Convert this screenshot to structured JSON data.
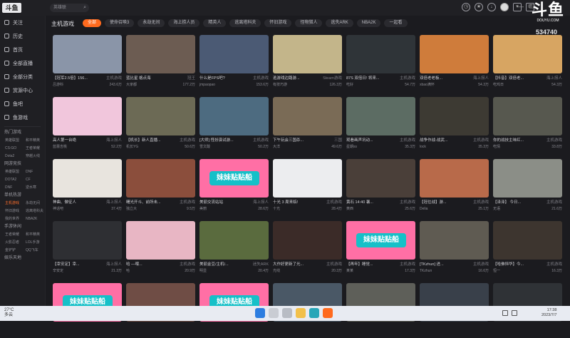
{
  "topbar": {
    "logo_text": "斗鱼",
    "search_placeholder": "英雄联",
    "icons": [
      "history-icon",
      "follow-icon",
      "download-icon",
      "live-icon",
      "avatar",
      "shirt-icon",
      "message-icon",
      "minimize-icon",
      "maximize-icon",
      "close-icon"
    ]
  },
  "watermark": {
    "brand": "斗鱼",
    "domain": "DOUYU.COM",
    "room_number": "534740"
  },
  "sidebar": {
    "nav": [
      {
        "label": "关注",
        "icon": "heart-icon"
      },
      {
        "label": "历史",
        "icon": "clock-icon"
      },
      {
        "label": "首页",
        "icon": "home-icon"
      },
      {
        "label": "全部直播",
        "icon": "grid-icon"
      },
      {
        "label": "全部分类",
        "icon": "category-icon"
      },
      {
        "label": "赏源中心",
        "icon": "gift-icon"
      },
      {
        "label": "鱼吧",
        "icon": "fish-icon"
      },
      {
        "label": "鱼游戏",
        "icon": "gamepad-icon"
      }
    ],
    "sections": [
      {
        "title": "热门游戏",
        "items": [
          "英雄联盟",
          "和平精英",
          "CS:GO",
          "王者荣耀",
          "Dota2",
          "穿越火线"
        ]
      },
      {
        "title": "网游竞技",
        "items": [
          "英雄联盟",
          "DNF",
          "DOTA2",
          "CF",
          "DNF",
          "逆水寒"
        ]
      },
      {
        "title": "单机热游",
        "items": [
          "主机游戏",
          "永劫无间",
          "怀旧游戏",
          "逃离塔科夫",
          "我的世界",
          "NBA2K"
        ]
      },
      {
        "title": "手游休闲",
        "items": [
          "王者荣耀",
          "和平精英",
          "火影忍者",
          "LOL手游",
          "金铲铲",
          "QQ飞车"
        ]
      },
      {
        "title": "娱乐天地",
        "items": []
      }
    ],
    "active_item": "主机游戏"
  },
  "content": {
    "title": "主机游戏",
    "tabs": [
      "全部",
      "使命召唤3",
      "永劫无间",
      "海上捞人员",
      "精英人",
      "逃离塔科夫",
      "怀旧游戏",
      "怪物猎人",
      "逃失ARK",
      "NBA2K",
      "一起看"
    ],
    "active_tab": "全部",
    "cards": [
      {
        "title": "【冠军2.5倍】156...",
        "cat": "主机游戏",
        "streamer": "吕游科",
        "views": "243.6万",
        "color": "#8a95a8"
      },
      {
        "title": "蓝比星 格点海",
        "cat": "冠王",
        "streamer": "大家都",
        "views": "177.2万",
        "color": "#6c5c52"
      },
      {
        "title": "什么是FPS吧?",
        "cat": "主机游戏",
        "streamer": "jmpaopao",
        "views": "153.6万",
        "color": "#4b5a74"
      },
      {
        "title": "逃游戏边路游...",
        "cat": "Steam游戏",
        "streamer": "有技巧游",
        "views": "126.3万",
        "color": "#c3b58a"
      },
      {
        "title": "87S 双倍日! 将来...",
        "cat": "主机游戏",
        "streamer": "吃好",
        "views": "54.7万",
        "color": "#2f3438"
      },
      {
        "title": "双倍老老板...",
        "cat": "海上捞人",
        "streamer": "xbao满怀",
        "views": "54.3万",
        "color": "#cf7c3b"
      },
      {
        "title": "【抖音】双倍老...",
        "cat": "海上捞人",
        "streamer": "吃鸡日",
        "views": "54.3万",
        "color": "#d7a562"
      },
      {
        "title": "高人第一台绝",
        "cat": "海上捞人",
        "streamer": "蓝蕾吉桃",
        "views": "52.2万",
        "color": "#f1c6dc"
      },
      {
        "title": "【机长】新人直播...",
        "cat": "主机游戏",
        "streamer": "机长YG",
        "views": "50.6万",
        "color": "#6c6a55"
      },
      {
        "title": "[大师] 怪扮演试游...",
        "cat": "主机游戏",
        "streamer": "雪文酸",
        "views": "50.2万",
        "color": "#4d6b80"
      },
      {
        "title": "下午玩会三国杀...",
        "cat": "三国",
        "streamer": "大洋",
        "views": "49.6万",
        "color": "#7a6b56"
      },
      {
        "title": "观看画声讯动...",
        "cat": "主机游戏",
        "streamer": "星期ss",
        "views": "35.3万",
        "color": "#5c6c63"
      },
      {
        "title": "战争作战-战武...",
        "cat": "主机游戏",
        "streamer": "lock",
        "views": "35.3万",
        "color": "#3d3a33"
      },
      {
        "title": "你的战技主味红...",
        "cat": "主机游戏",
        "streamer": "吃情",
        "views": "33.8万",
        "color": "#57584f"
      },
      {
        "title": "神曲、做征人",
        "cat": "海上捞人",
        "streamer": "神话吧",
        "views": "37.4万",
        "color": "#e8e4de"
      },
      {
        "title": "曙光开斗、前所未...",
        "cat": "主机游戏",
        "streamer": "独立大",
        "views": "9.5万",
        "color": "#8b4e3c"
      },
      {
        "title": "美丽交流站站",
        "cat": "海上捞人",
        "streamer": "美丽",
        "views": "28.6万",
        "color": "#ff6fa5"
      },
      {
        "title": "十光 3 周来临!",
        "cat": "主机游戏",
        "streamer": "十光",
        "views": "28.4万",
        "color": "#ecedef"
      },
      {
        "title": "黄石 14:40 暑...",
        "cat": "主机游戏",
        "streamer": "黄西",
        "views": "25.6万",
        "color": "#4a3f39"
      },
      {
        "title": "【冠位战】游...",
        "cat": "主机游戏",
        "streamer": "Delia",
        "views": "25.1万",
        "color": "#b86a4a"
      },
      {
        "title": "【泽泽】 今日...",
        "cat": "主机游戏",
        "streamer": "无语",
        "views": "21.6万",
        "color": "#8b8e87"
      },
      {
        "title": "【幸安定】幸...",
        "cat": "海上捞人",
        "streamer": "辛安定",
        "views": "21.3万",
        "color": "#2e2f33"
      },
      {
        "title": "哈 —喂...",
        "cat": "主机游戏",
        "streamer": "哈",
        "views": "20.9万",
        "color": "#e8b6c4"
      },
      {
        "title": "美丽金豆/主机/...",
        "cat": "迷失ARK",
        "streamer": "明显",
        "views": "20.4万",
        "color": "#5a6b3e"
      },
      {
        "title": "大作好更新了光...",
        "cat": "主机游戏",
        "streamer": "光线",
        "views": "20.3万",
        "color": "#3b2b28"
      },
      {
        "title": "【再年】睡觉...",
        "cat": "主机游戏",
        "streamer": "某某",
        "views": "17.3万",
        "color": "#ff6fa5"
      },
      {
        "title": "[TKzhun] 进...",
        "cat": "主机游戏",
        "streamer": "TKzhun",
        "views": "16.6万",
        "color": "#5f5b52"
      },
      {
        "title": "【哈佛恒华】今...",
        "cat": "主机游戏",
        "streamer": "恒一",
        "views": "16.3万",
        "color": "#3d352f"
      },
      {
        "title": "",
        "cat": "",
        "streamer": "",
        "views": "",
        "color": "#ff6fa5"
      },
      {
        "title": "",
        "cat": "",
        "streamer": "",
        "views": "",
        "color": "#6f4d45"
      },
      {
        "title": "",
        "cat": "",
        "streamer": "",
        "views": "",
        "color": "#ff6fa5"
      },
      {
        "title": "",
        "cat": "",
        "streamer": "",
        "views": "",
        "color": "#4a5866"
      },
      {
        "title": "",
        "cat": "",
        "streamer": "",
        "views": "",
        "color": "#5e5f59"
      },
      {
        "title": "",
        "cat": "",
        "streamer": "",
        "views": "",
        "color": "#39404a"
      },
      {
        "title": "",
        "cat": "",
        "streamer": "",
        "views": "",
        "color": "#2f3236"
      }
    ],
    "banner_text": "妹妹贴贴船"
  },
  "taskbar": {
    "weather_temp": "27°C",
    "weather_desc": "多云",
    "time": "17:38",
    "date": "2023/7/7"
  }
}
